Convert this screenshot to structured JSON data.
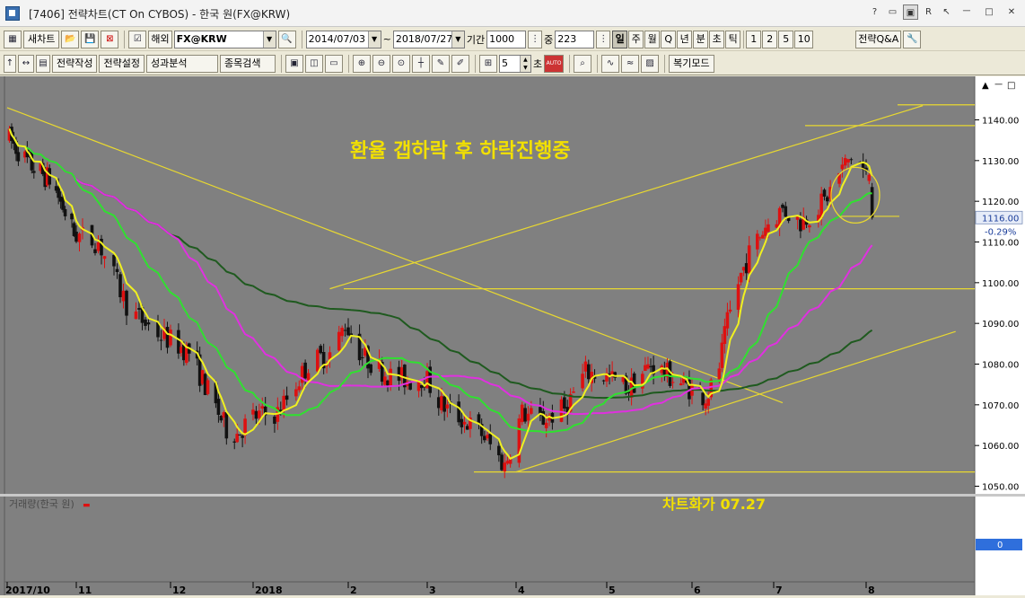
{
  "window": {
    "title": "[7406] 전략차트(CT On CYBOS) - 한국 원(FX@KRW)",
    "controls": [
      "?",
      "▭",
      "▣",
      "R",
      "↖",
      "ㅡ",
      "□",
      "✕"
    ]
  },
  "toolbar1": {
    "new_chart": "새차트",
    "overseas": "해외",
    "symbol": "FX@KRW",
    "date_from": "2014/07/03",
    "date_tilde": "~",
    "date_to": "2018/07/27",
    "period_label": "기간",
    "period_value": "1000",
    "count_label": "중",
    "count_value": "223",
    "periods": [
      "일",
      "주",
      "월",
      "Q",
      "년",
      "분",
      "초",
      "틱"
    ],
    "active_period": "일",
    "multipliers": [
      "1",
      "2",
      "5",
      "10"
    ],
    "strategy_qa": "전략Q&A"
  },
  "toolbar2": {
    "strategy_make": "전략작성",
    "strategy_settings": "전략설정",
    "performance": "성과분석",
    "symbol_search": "종목검색",
    "interval_value": "5",
    "interval_unit": "초",
    "auto": "AUTO",
    "replay_mode": "복기모드"
  },
  "chart": {
    "annotation_title": "환율 갭하락 후 하락진행중",
    "annotation_note": "차트화가 07.27",
    "volume_label": "거래량(한국 원)",
    "volume_marker": "▬",
    "current_price": "1116.00",
    "change_pct": "-0.29%",
    "volume_value": "0",
    "price_ticks": [
      "1140.00",
      "1130.00",
      "1120.00",
      "1110.00",
      "1100.00",
      "1090.00",
      "1080.00",
      "1070.00",
      "1060.00",
      "1050.00"
    ],
    "x_labels": [
      "2017/10",
      "11",
      "12",
      "2018",
      "2",
      "3",
      "4",
      "5",
      "6",
      "7",
      "8"
    ],
    "colors": {
      "bg": "#808080",
      "up": "#dd1111",
      "down": "#111111",
      "ma5": "#f0f020",
      "ma20": "#30e030",
      "ma60": "#e030e0",
      "ma120": "#1f5a1f",
      "lines": "#e8d830",
      "text": "#f2e000"
    }
  },
  "chart_data": {
    "type": "candlestick",
    "series": [
      {
        "name": "FX@KRW 일봉",
        "ohlc_range": [
          1053,
          1143
        ]
      }
    ],
    "y_range": [
      1046,
      1146
    ],
    "current": 1116.0,
    "change_pct": -0.29,
    "horizontal_levels": [
      1098.5,
      1053.5,
      1116.3,
      1138.6,
      1143.7
    ],
    "trendlines": [
      {
        "from": [
          "2017-10-01",
          1143
        ],
        "to": [
          "2018-07-04",
          1070.5
        ]
      },
      {
        "from": [
          "2018-04-01",
          1053.5
        ],
        "to": [
          "2018-08-31",
          1088
        ]
      },
      {
        "from": [
          "2018-01-26",
          1098.5
        ],
        "to": [
          "2018-08-20",
          1143.5
        ]
      }
    ]
  }
}
